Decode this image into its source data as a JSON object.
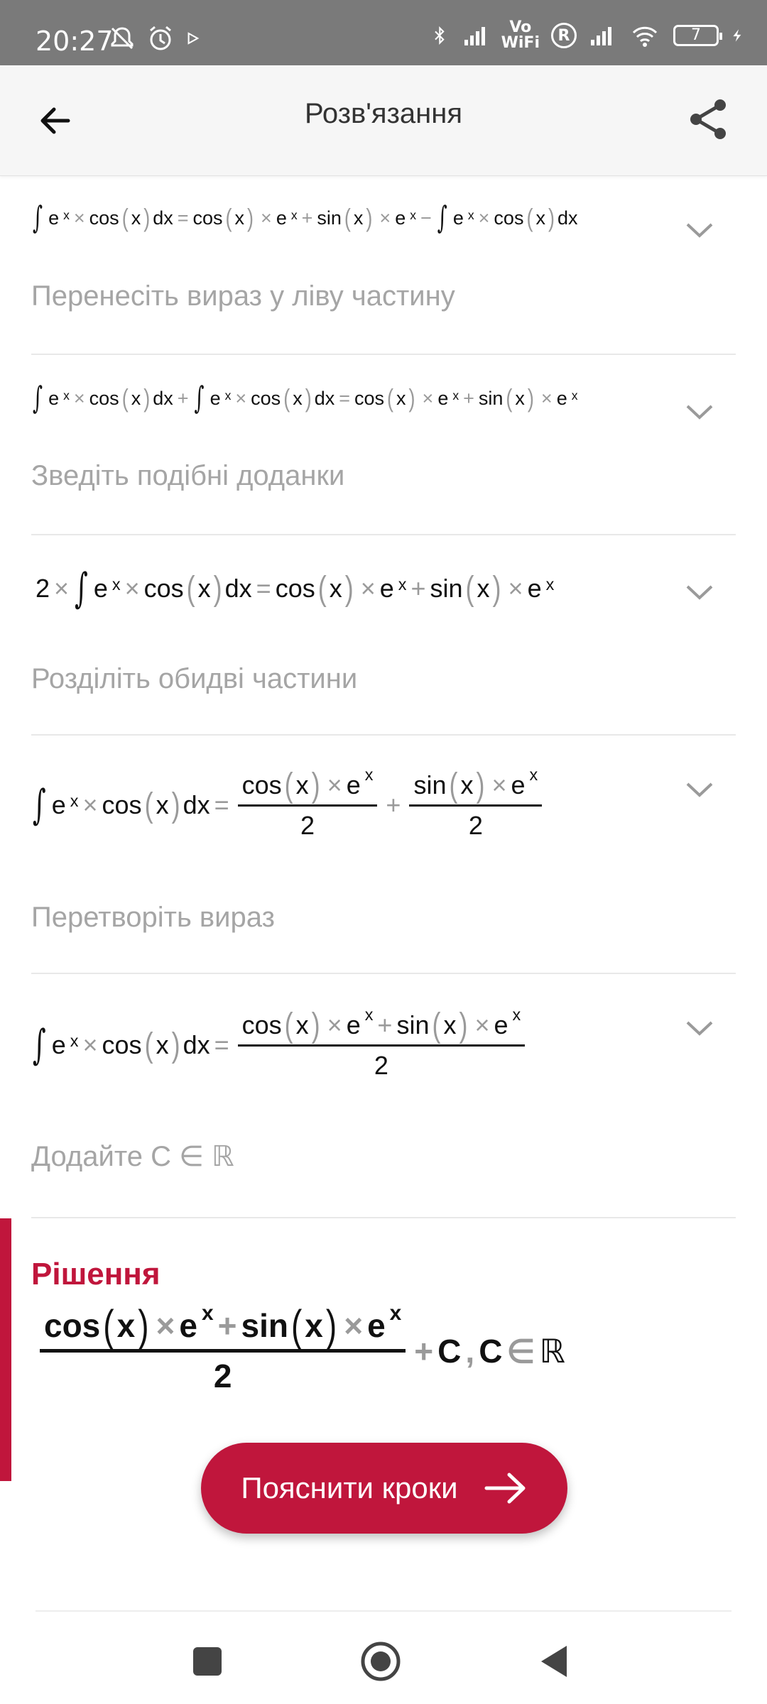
{
  "status_bar": {
    "time": "20:27",
    "vowifi_top": "Vo",
    "vowifi_bottom": "WiFi",
    "roaming": "R",
    "battery": "7"
  },
  "app_bar": {
    "title": "Розв'язання",
    "back_icon": "arrow-left-icon",
    "share_icon": "share-icon"
  },
  "steps": [
    {
      "caption": "Перенесіть вираз у ліву частину",
      "formula": {
        "lhs": [
          "e",
          "x",
          "×",
          "cos",
          "x",
          "dx",
          "="
        ],
        "rhs": [
          "cos",
          "x",
          "×",
          "e",
          "x",
          "+",
          "sin",
          "x",
          "×",
          "e",
          "x",
          "−",
          "e",
          "x",
          "×",
          "cos",
          "x",
          "dx"
        ]
      }
    },
    {
      "caption": "Зведіть подібні доданки",
      "formula": {
        "lhs": [
          "e",
          "x",
          "×",
          "cos",
          "x",
          "dx",
          "+",
          "e",
          "x",
          "×",
          "cos",
          "x",
          "dx",
          "="
        ],
        "rhs": [
          "cos",
          "x",
          "×",
          "e",
          "x",
          "+",
          "sin",
          "x",
          "×",
          "e",
          "x"
        ]
      }
    },
    {
      "caption": "Розділіть обидві частини",
      "formula": {
        "coef": "2",
        "times": "×",
        "lhs": [
          "e",
          "x",
          "×",
          "cos",
          "x",
          "dx",
          "="
        ],
        "rhs": [
          "cos",
          "x",
          "×",
          "e",
          "x",
          "+",
          "sin",
          "x",
          "×",
          "e",
          "x"
        ]
      }
    },
    {
      "caption": "Перетворіть вираз",
      "formula": {
        "lhs": [
          "e",
          "x",
          "×",
          "cos",
          "x",
          "dx",
          "="
        ],
        "frac1_num": [
          "cos",
          "x",
          "×",
          "e",
          "x"
        ],
        "frac1_den": "2",
        "plus": "+",
        "frac2_num": [
          "sin",
          "x",
          "×",
          "e",
          "x"
        ],
        "frac2_den": "2"
      }
    },
    {
      "caption": "Додайте C ∈ ℝ",
      "formula": {
        "lhs": [
          "e",
          "x",
          "×",
          "cos",
          "x",
          "dx",
          "="
        ],
        "num": [
          "cos",
          "x",
          "×",
          "e",
          "x",
          "+",
          "sin",
          "x",
          "×",
          "e",
          "x"
        ],
        "den": "2"
      }
    }
  ],
  "solution": {
    "title": "Рішення",
    "num": [
      "cos",
      "x",
      "×",
      "e",
      "x",
      "+",
      "sin",
      "x",
      "×",
      "e",
      "x"
    ],
    "den": "2",
    "plus": "+",
    "const": "C",
    "comma": ",",
    "const2": "C",
    "in": "∈",
    "reals": "ℝ"
  },
  "explain_button": {
    "label": "Пояснити кроки"
  },
  "colors": {
    "accent": "#c0163c",
    "caption": "#a5a5a5",
    "operator": "#9a9a9a"
  }
}
